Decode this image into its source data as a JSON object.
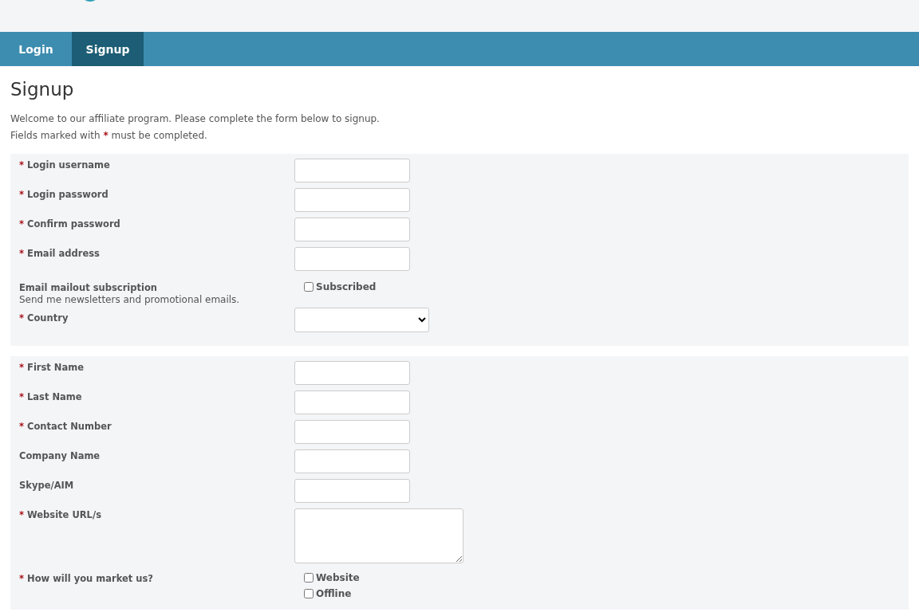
{
  "tabs": [
    {
      "label": "Login",
      "selected": false
    },
    {
      "label": "Signup",
      "selected": true
    }
  ],
  "heading": "Signup",
  "intro": "Welcome to our affiliate program. Please complete the form below to signup.",
  "note": {
    "before": "Fields marked with",
    "mark": "*",
    "after": "must be completed."
  },
  "sections": [
    {
      "fields": [
        {
          "kind": "text",
          "label": "Login username",
          "required": true
        },
        {
          "kind": "text",
          "label": "Login password",
          "required": true
        },
        {
          "kind": "text",
          "label": "Confirm password",
          "required": true
        },
        {
          "kind": "text",
          "label": "Email address",
          "required": true
        },
        {
          "kind": "checkbox",
          "label": "Email mailout subscription",
          "description": "Send me newsletters and promotional emails.",
          "required": false,
          "options": [
            {
              "label": "Subscribed",
              "checked": false
            }
          ]
        },
        {
          "kind": "select",
          "label": "Country",
          "required": true
        }
      ]
    },
    {
      "fields": [
        {
          "kind": "text",
          "label": "First Name",
          "required": true
        },
        {
          "kind": "text",
          "label": "Last Name",
          "required": true
        },
        {
          "kind": "text",
          "label": "Contact Number",
          "required": true
        },
        {
          "kind": "text",
          "label": "Company Name",
          "required": false
        },
        {
          "kind": "text",
          "label": "Skype/AIM",
          "required": false
        },
        {
          "kind": "textarea",
          "label": "Website URL/s",
          "required": true
        },
        {
          "kind": "checkbox",
          "label": "How will you market us?",
          "required": true,
          "options": [
            {
              "label": "Website",
              "checked": false
            },
            {
              "label": "Offline",
              "checked": false
            }
          ]
        }
      ]
    }
  ]
}
